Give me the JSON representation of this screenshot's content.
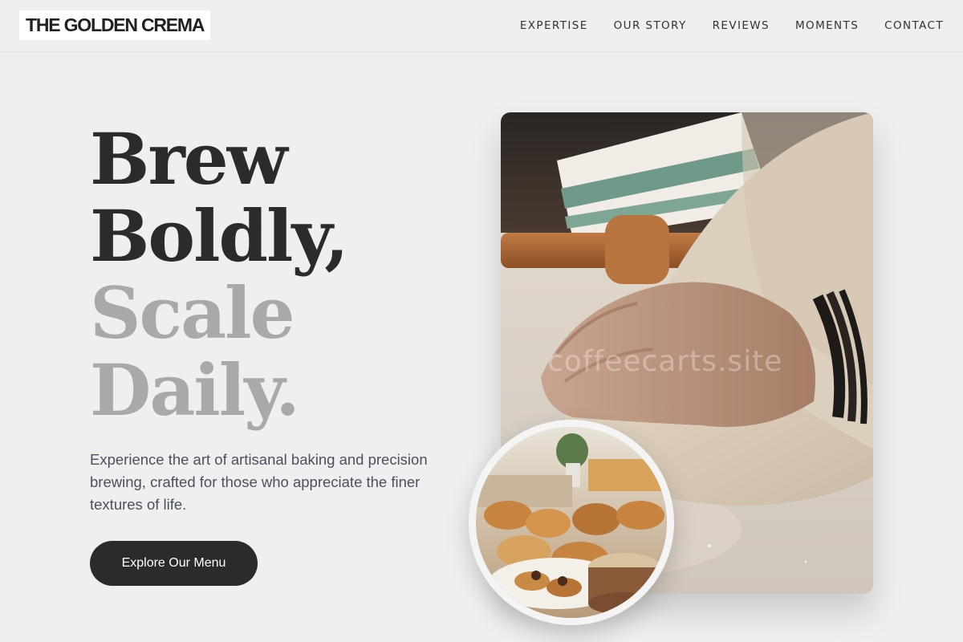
{
  "brand": {
    "logo_text": "THE GOLDEN CREMA"
  },
  "nav": {
    "items": [
      {
        "label": "EXPERTISE"
      },
      {
        "label": "OUR STORY"
      },
      {
        "label": "REVIEWS"
      },
      {
        "label": "MOMENTS"
      },
      {
        "label": "CONTACT"
      }
    ]
  },
  "hero": {
    "headline_lines": [
      {
        "text": "Brew",
        "tone": "dark"
      },
      {
        "text": "Boldly,",
        "tone": "dark"
      },
      {
        "text": "Scale",
        "tone": "light"
      },
      {
        "text": "Daily.",
        "tone": "light"
      }
    ],
    "description": "Experience the art of artisanal baking and precision brewing, crafted for those who appreciate the finer textures of life.",
    "cta_label": "Explore Our Menu",
    "watermark_text": "coffeecarts.site"
  },
  "colors": {
    "background": "#efefef",
    "dark_text": "#2b2b2b",
    "muted_text": "#a9a9a9",
    "body_text": "#4a5160",
    "cta_background": "#2b2b2b"
  }
}
